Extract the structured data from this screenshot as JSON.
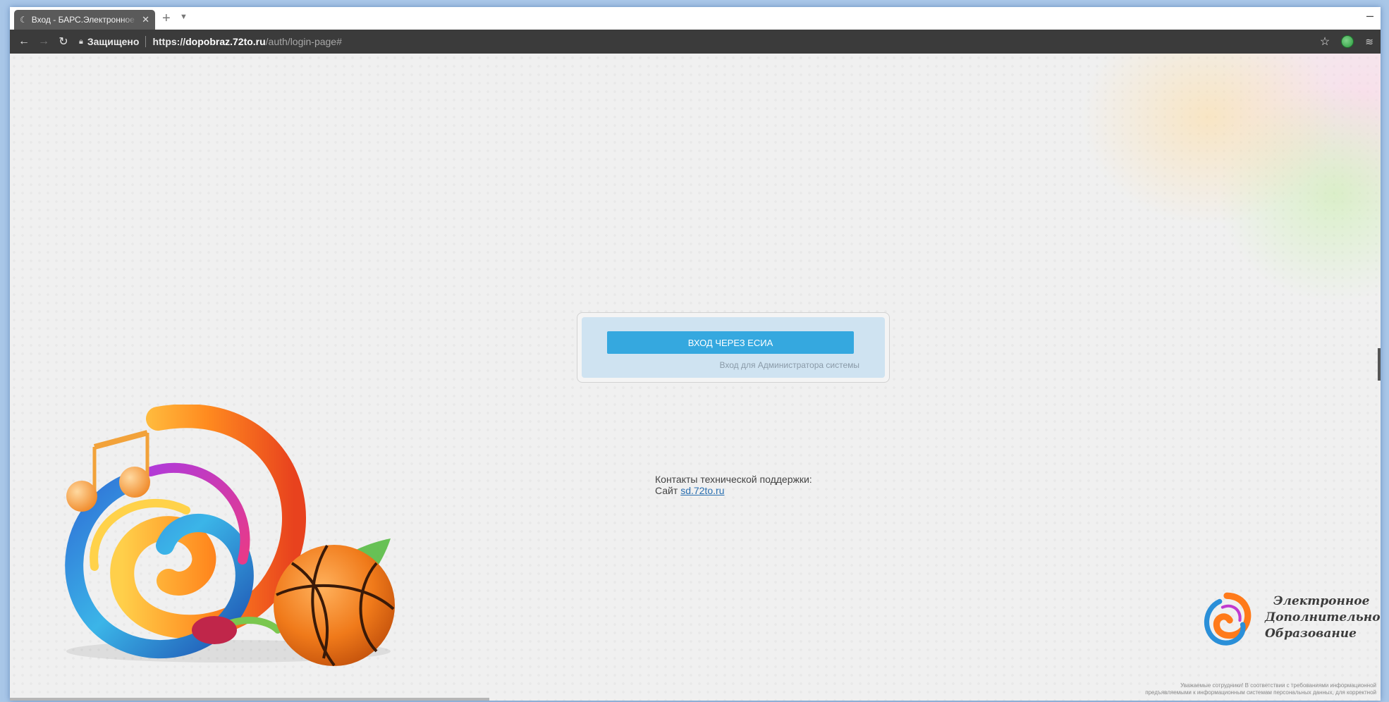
{
  "browser": {
    "tab": {
      "title": "Вход - БАРС.Электронное",
      "icon": "moon-favicon-icon"
    },
    "toolbar": {
      "secure_label": "Защищено",
      "url_scheme": "https://",
      "url_host": "dopobraz.72to.ru",
      "url_path": "/auth/login-page#"
    }
  },
  "login": {
    "esia_button_label": "ВХОД ЧЕРЕЗ ЕСИА",
    "admin_link_label": "Вход для Администратора системы"
  },
  "support": {
    "heading": "Контакты технической поддержки:",
    "site_label": "Сайт",
    "site_link": "sd.72to.ru"
  },
  "brand": {
    "line1": "Электронное",
    "line2": "Дополнительное",
    "line3": "Образование"
  },
  "footer_notice": {
    "line1": "Уважаемые сотрудники! В соответствии с требованиями информационной",
    "line2": "предъявляемыми к информационным системам персональных данных, для корректной"
  },
  "colors": {
    "accent": "#35a8df",
    "login_panel": "#cfe3f1",
    "toolbar": "#3b3b3b",
    "link": "#2a6fb0"
  }
}
